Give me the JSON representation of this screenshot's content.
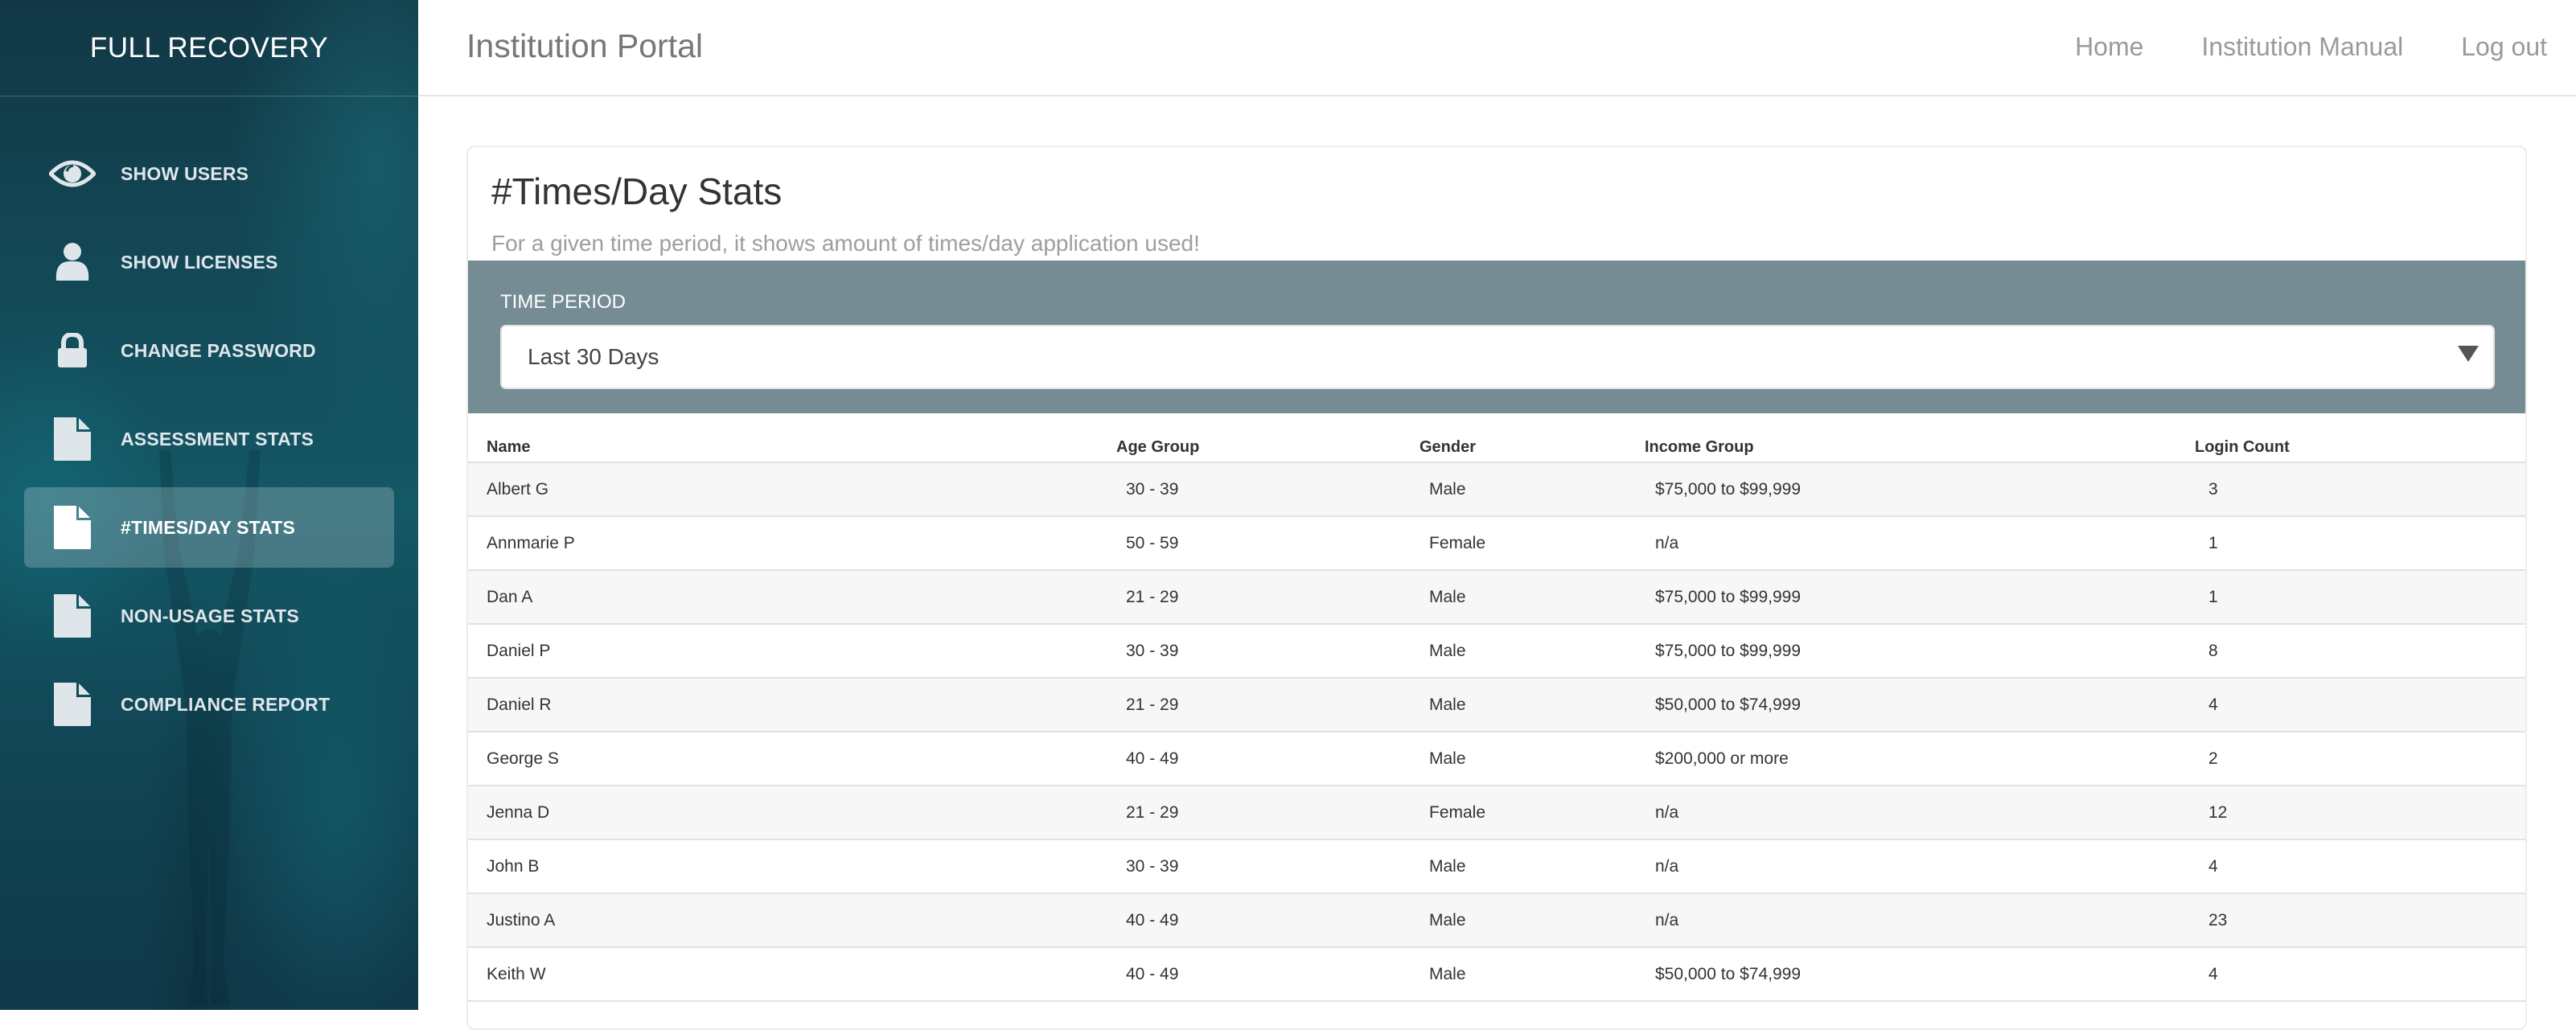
{
  "sidebar": {
    "brand": "FULL RECOVERY",
    "items": [
      {
        "label": "SHOW USERS",
        "icon": "eye-icon",
        "active": false
      },
      {
        "label": "SHOW LICENSES",
        "icon": "user-icon",
        "active": false
      },
      {
        "label": "CHANGE PASSWORD",
        "icon": "lock-icon",
        "active": false
      },
      {
        "label": "ASSESSMENT STATS",
        "icon": "document-icon",
        "active": false
      },
      {
        "label": "#TIMES/DAY STATS",
        "icon": "document-icon",
        "active": true
      },
      {
        "label": "NON-USAGE STATS",
        "icon": "document-icon",
        "active": false
      },
      {
        "label": "COMPLIANCE REPORT",
        "icon": "document-icon",
        "active": false
      }
    ]
  },
  "header": {
    "title": "Institution Portal",
    "nav": [
      {
        "label": "Home"
      },
      {
        "label": "Institution Manual"
      },
      {
        "label": "Log out"
      }
    ]
  },
  "page": {
    "title": "#Times/Day Stats",
    "subtitle": "For a given time period, it shows amount of times/day application used!",
    "filter": {
      "label": "TIME PERIOD",
      "selected": "Last 30 Days"
    }
  },
  "table": {
    "columns": [
      "Name",
      "Age Group",
      "Gender",
      "Income Group",
      "Login Count"
    ],
    "rows": [
      [
        "Albert G",
        "30 - 39",
        "Male",
        "$75,000 to $99,999",
        "3"
      ],
      [
        "Annmarie P",
        "50 - 59",
        "Female",
        "n/a",
        "1"
      ],
      [
        "Dan A",
        "21 - 29",
        "Male",
        "$75,000 to $99,999",
        "1"
      ],
      [
        "Daniel P",
        "30 - 39",
        "Male",
        "$75,000 to $99,999",
        "8"
      ],
      [
        "Daniel R",
        "21 - 29",
        "Male",
        "$50,000 to $74,999",
        "4"
      ],
      [
        "George S",
        "40 - 49",
        "Male",
        "$200,000 or more",
        "2"
      ],
      [
        "Jenna D",
        "21 - 29",
        "Female",
        "n/a",
        "12"
      ],
      [
        "John B",
        "30 - 39",
        "Male",
        "n/a",
        "4"
      ],
      [
        "Justino A",
        "40 - 49",
        "Male",
        "n/a",
        "23"
      ],
      [
        "Keith W",
        "40 - 49",
        "Male",
        "$50,000 to $74,999",
        "4"
      ]
    ]
  },
  "colors": {
    "sidebar_bg": "#134a58",
    "filter_band": "#758c95",
    "row_stripe": "#f7f7f7"
  }
}
